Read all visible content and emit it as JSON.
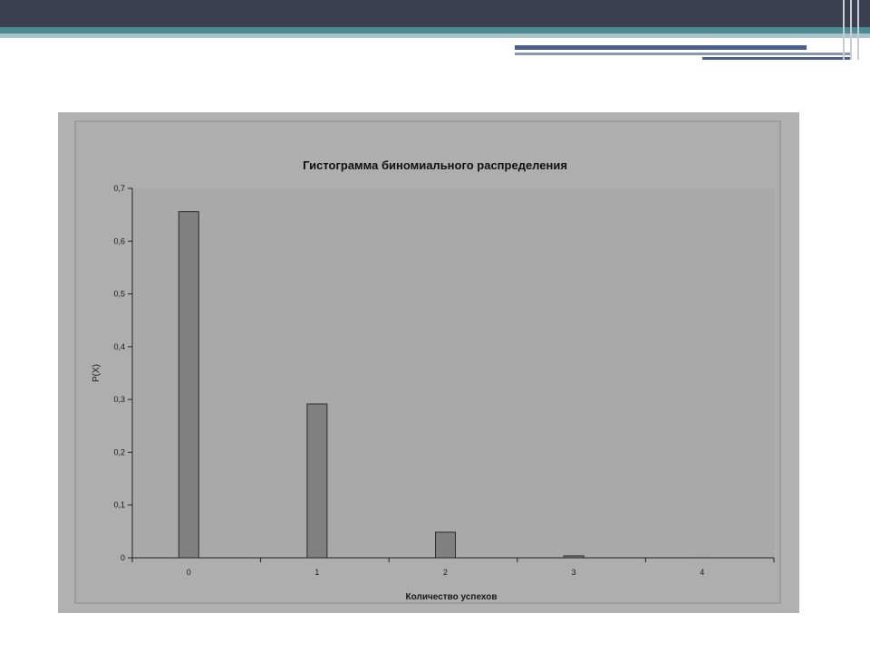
{
  "chart_data": {
    "type": "bar",
    "title": "Гистограмма биномиального распределения",
    "xlabel": "Количество успехов",
    "ylabel": "P(X)",
    "categories": [
      "0",
      "1",
      "2",
      "3",
      "4"
    ],
    "values": [
      0.656,
      0.2916,
      0.0486,
      0.0036,
      0.0001
    ],
    "ylim": [
      0,
      0.7
    ],
    "yticks": [
      "0",
      "0,1",
      "0,2",
      "0,3",
      "0,4",
      "0,5",
      "0,6",
      "0,7"
    ],
    "legend": "none",
    "grid": false,
    "colors": {
      "bar": "#808080",
      "bar_stroke": "#2a2a2a",
      "plot_bg": "#aaaaaa",
      "figure_bg": "#b1b1b1"
    }
  }
}
